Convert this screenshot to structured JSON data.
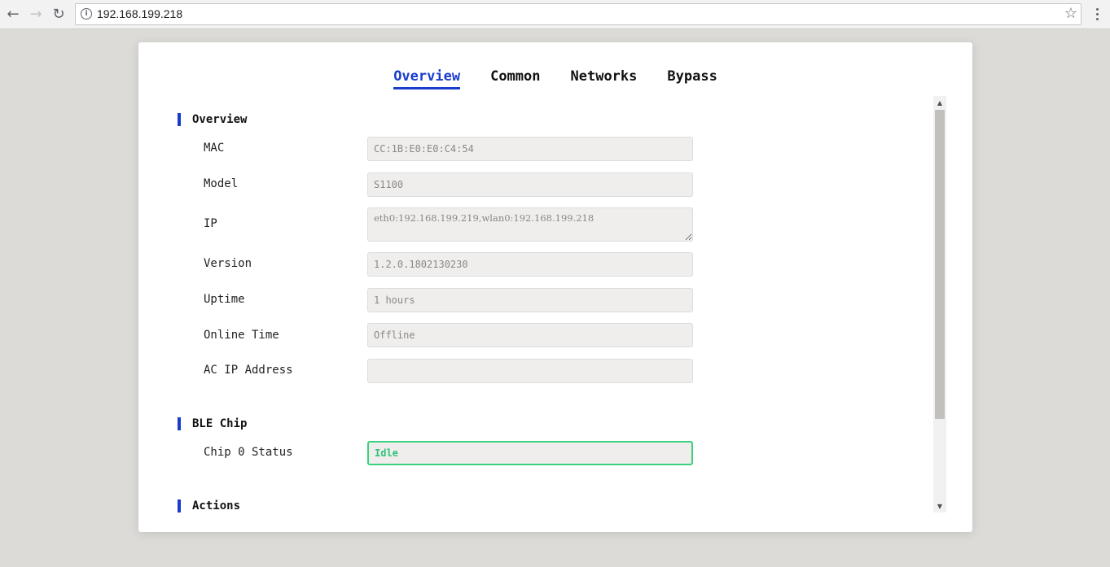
{
  "browser": {
    "back_icon": "back-arrow-icon",
    "forward_icon": "forward-arrow-icon",
    "reload_icon": "reload-icon",
    "url": "192.168.199.218",
    "info_glyph": "i"
  },
  "tabs": [
    {
      "label": "Overview",
      "active": true
    },
    {
      "label": "Common",
      "active": false
    },
    {
      "label": "Networks",
      "active": false
    },
    {
      "label": "Bypass",
      "active": false
    }
  ],
  "overview": {
    "title": "Overview",
    "fields": [
      {
        "label": "MAC",
        "value": "CC:1B:E0:E0:C4:54"
      },
      {
        "label": "Model",
        "value": "S1100"
      },
      {
        "label": "IP",
        "value": "eth0:192.168.199.219,wlan0:192.168.199.218"
      },
      {
        "label": "Version",
        "value": "1.2.0.1802130230"
      },
      {
        "label": "Uptime",
        "value": "1 hours"
      },
      {
        "label": "Online Time",
        "value": "Offline"
      },
      {
        "label": "AC IP Address",
        "value": ""
      }
    ]
  },
  "ble": {
    "title": "BLE Chip",
    "chip0_label": "Chip 0 Status",
    "chip0_value": "Idle"
  },
  "actions": {
    "title": "Actions"
  },
  "colors": {
    "accent": "#1a3bcc",
    "status_ok": "#2ec27a"
  }
}
